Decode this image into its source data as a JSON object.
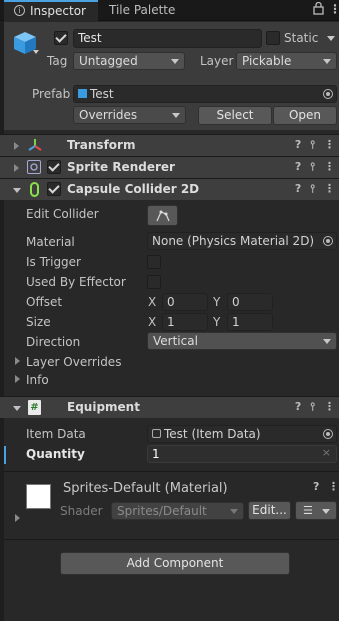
{
  "tabs": [
    {
      "label": "Inspector"
    },
    {
      "label": "Tile Palette"
    }
  ],
  "object": {
    "name": "Test",
    "static_label": "Static",
    "tag_label": "Tag",
    "tag_value": "Untagged",
    "layer_label": "Layer",
    "layer_value": "Pickable",
    "prefab_label": "Prefab",
    "prefab_value": "Test",
    "overrides_label": "Overrides",
    "select_label": "Select",
    "open_label": "Open"
  },
  "components": {
    "transform": "Transform",
    "sprite_renderer": "Sprite Renderer",
    "capsule_collider": "Capsule Collider 2D",
    "equipment": "Equipment"
  },
  "collider": {
    "edit_collider": "Edit Collider",
    "material_label": "Material",
    "material_value": "None (Physics Material 2D)",
    "is_trigger": "Is Trigger",
    "used_by_effector": "Used By Effector",
    "offset_label": "Offset",
    "offset_x": "0",
    "offset_y": "0",
    "size_label": "Size",
    "size_x": "1",
    "size_y": "1",
    "x_label": "X",
    "y_label": "Y",
    "direction_label": "Direction",
    "direction_value": "Vertical",
    "layer_overrides": "Layer Overrides",
    "info": "Info"
  },
  "equipment": {
    "item_data_label": "Item Data",
    "item_data_value": "Test (Item Data)",
    "quantity_label": "Quantity",
    "quantity_value": "1"
  },
  "material": {
    "name": "Sprites-Default (Material)",
    "shader_label": "Shader",
    "shader_value": "Sprites/Default",
    "edit_label": "Edit..."
  },
  "add_component": "Add Component",
  "colors": {
    "background": "#282828",
    "header": "#3e3e3e",
    "accent_blue": "#4aa3e0",
    "collider_green": "#8ce04a"
  }
}
